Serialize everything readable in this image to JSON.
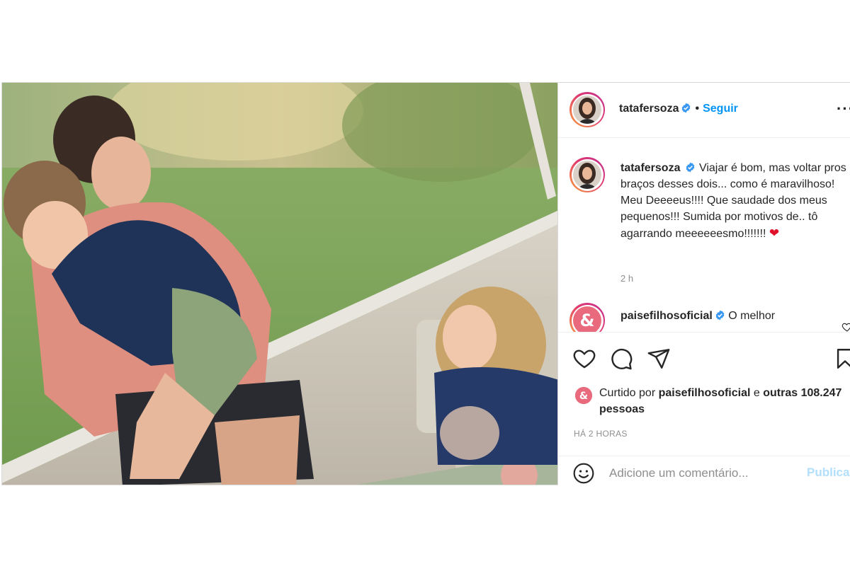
{
  "post": {
    "username": "tatafersoza",
    "separator": "•",
    "follow_label": "Seguir",
    "more_label": "···"
  },
  "caption": {
    "username": "tatafersoza",
    "text": "Viajar é bom, mas voltar pros braços desses dois... como é maravilhoso! Meu Deeeeus!!!! Que saudade dos meus pequenos!!! Sumida por motivos de.. tô agarrando meeeeeesmo!!!!!!!",
    "emoji": "❤",
    "time": "2 h"
  },
  "comments": [
    {
      "username": "paisefilhosoficial",
      "text": "O melhor"
    }
  ],
  "likes": {
    "prefix": "Curtido por",
    "user": "paisefilhosoficial",
    "connector": "e",
    "others": "outras 108.247 pessoas"
  },
  "timestamp": "HÁ 2 HORAS",
  "comment_box": {
    "placeholder": "Adicione um comentário...",
    "publish_label": "Publicar"
  },
  "colors": {
    "link_blue": "#0095f6",
    "publish_disabled": "#b2dffc",
    "muted": "#8e8e8e",
    "avatar_ring_start": "#f9a33e",
    "avatar_ring_end": "#c22f92"
  },
  "icons": [
    "verified-badge-icon",
    "more-options-icon",
    "heart-icon",
    "comment-icon",
    "share-icon",
    "bookmark-icon",
    "emoji-icon",
    "like-comment-heart-icon"
  ]
}
